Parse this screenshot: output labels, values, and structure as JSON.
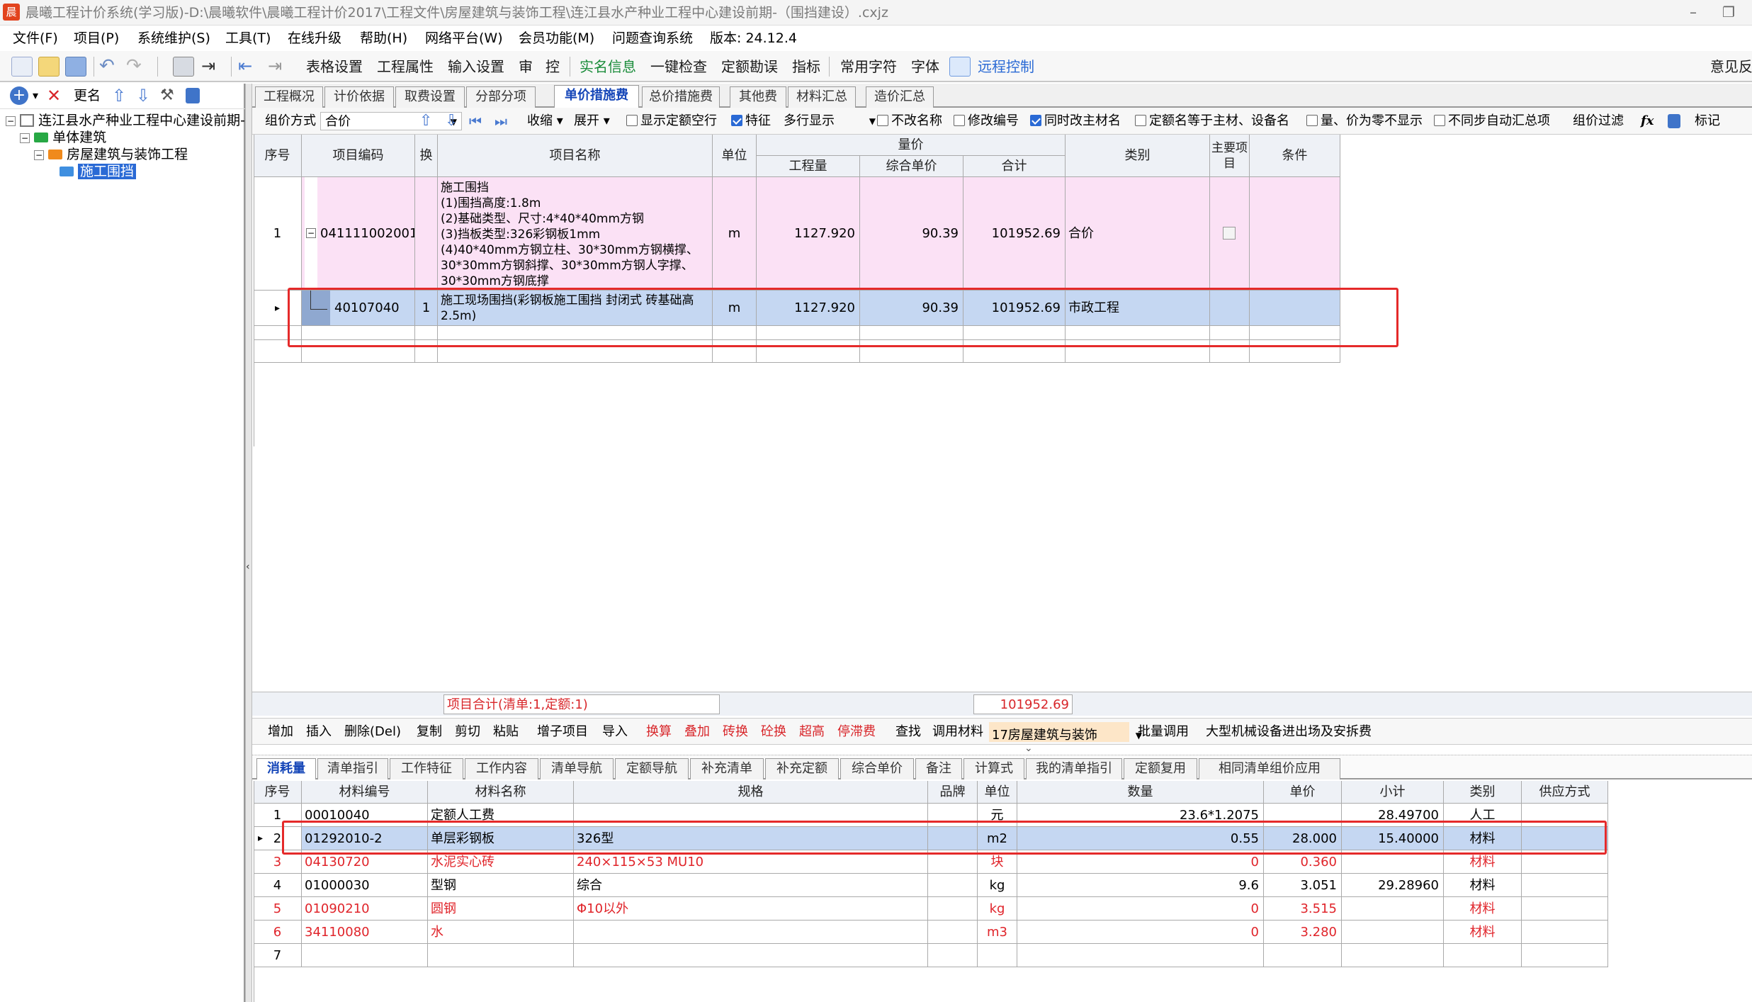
{
  "window": {
    "title": "晨曦工程计价系统(学习版)-D:\\晨曦软件\\晨曦工程计价2017\\工程文件\\房屋建筑与装饰工程\\连江县水产种业工程中心建设前期-（围挡建设）.cxjz",
    "logo": "晨"
  },
  "menu": [
    "文件(F)",
    "项目(P)",
    "系统维护(S)",
    "工具(T)",
    "在线升级",
    "帮助(H)",
    "网络平台(W)",
    "会员功能(M)",
    "问题查询系统",
    "版本: 24.12.4"
  ],
  "toolbar": {
    "items": [
      "表格设置",
      "工程属性",
      "输入设置",
      "审",
      "控",
      "实名信息",
      "一键检查",
      "定额勘误",
      "指标",
      "常用字符",
      "字体",
      "远程控制"
    ],
    "feedback": "意见反"
  },
  "left": {
    "rename": "更名",
    "tree": [
      "连江县水产种业工程中心建设前期-",
      "单体建筑",
      "房屋建筑与装饰工程",
      "施工围挡"
    ]
  },
  "tabs": [
    "工程概况",
    "计价依据",
    "取费设置",
    "分部分项",
    "单价措施费",
    "总价措施费",
    "其他费",
    "材料汇总",
    "造价汇总"
  ],
  "options": {
    "zujia_label": "组价方式",
    "zujia_value": "合价",
    "shousuo": "收缩",
    "zhankai": "展开",
    "xianshi": "显示定额空行",
    "tezheng": "特征",
    "duohang": "多行显示",
    "bugai": "不改名称",
    "xiugai": "修改编号",
    "tongshi": "同时改主材名",
    "dingming": "定额名等于主材、设备名",
    "liangjia": "量、价为零不显示",
    "butongbu": "不同步自动汇总项",
    "guolv": "组价过滤",
    "fx": "fx",
    "biaoji": "标记"
  },
  "grid": {
    "headers": {
      "seq": "序号",
      "code": "项目编码",
      "huan": "换",
      "name": "项目名称",
      "unit": "单位",
      "liangjia": "量价",
      "qty": "工程量",
      "price": "综合单价",
      "total": "合计",
      "type": "类别",
      "main": "主要项目",
      "cond": "条件"
    },
    "row1": {
      "seq": "1",
      "code": "041111002001",
      "name": [
        "施工围挡",
        "(1)围挡高度:1.8m",
        "(2)基础类型、尺寸:4*40*40mm方钢",
        "(3)挡板类型:326彩钢板1mm",
        "(4)40*40mm方钢立柱、30*30mm方钢横撑、",
        "30*30mm方钢斜撑、30*30mm方钢人字撑、",
        "30*30mm方钢底撑"
      ],
      "unit": "m",
      "qty": "1127.920",
      "price": "90.39",
      "total": "101952.69",
      "type": "合价"
    },
    "row2": {
      "pointer": "▸",
      "code": "40107040",
      "huan": "1",
      "name": "施工现场围挡(彩钢板施工围挡 封闭式 砖基础高2.5m)",
      "unit": "m",
      "qty": "1127.920",
      "price": "90.39",
      "total": "101952.69",
      "type": "市政工程"
    },
    "sum_label": "项目合计(清单:1,定额:1)",
    "sum_value": "101952.69"
  },
  "bottom_tools": [
    "增加",
    "插入",
    "删除(Del)",
    "复制",
    "剪切",
    "粘贴",
    "增子项目",
    "导入",
    "换算",
    "叠加",
    "砖换",
    "砼换",
    "超高",
    "停滞费",
    "查找",
    "调用材料",
    "17房屋建筑与装饰",
    "批量调用",
    "大型机械设备进出场及安拆费"
  ],
  "bottom_tabs": [
    "消耗量",
    "清单指引",
    "工作特征",
    "工作内容",
    "清单导航",
    "定额导航",
    "补充清单",
    "补充定额",
    "综合单价",
    "备注",
    "计算式",
    "我的清单指引",
    "定额复用",
    "相同清单组价应用"
  ],
  "mat": {
    "headers": [
      "序号",
      "材料编号",
      "材料名称",
      "规格",
      "品牌",
      "单位",
      "数量",
      "单价",
      "小计",
      "类别",
      "供应方式"
    ],
    "rows": [
      {
        "seq": "1",
        "code": "00010040",
        "name": "定额人工费",
        "spec": "",
        "unit": "元",
        "qty": "23.6*1.2075",
        "price": "",
        "sub": "28.49700",
        "type": "人工",
        "red": false
      },
      {
        "seq": "2",
        "code": "01292010-2",
        "name": "单层彩钢板",
        "spec": "326型",
        "unit": "m2",
        "qty": "0.55",
        "price": "28.000",
        "sub": "15.40000",
        "type": "材料",
        "red": false
      },
      {
        "seq": "3",
        "code": "04130720",
        "name": "水泥实心砖",
        "spec": "240×115×53 MU10",
        "unit": "块",
        "qty": "0",
        "price": "0.360",
        "sub": "",
        "type": "材料",
        "red": true
      },
      {
        "seq": "4",
        "code": "01000030",
        "name": "型钢",
        "spec": "综合",
        "unit": "kg",
        "qty": "9.6",
        "price": "3.051",
        "sub": "29.28960",
        "type": "材料",
        "red": false
      },
      {
        "seq": "5",
        "code": "01090210",
        "name": "圆钢",
        "spec": "Φ10以外",
        "unit": "kg",
        "qty": "0",
        "price": "3.515",
        "sub": "",
        "type": "材料",
        "red": true
      },
      {
        "seq": "6",
        "code": "34110080",
        "name": "水",
        "spec": "",
        "unit": "m3",
        "qty": "0",
        "price": "3.280",
        "sub": "",
        "type": "材料",
        "red": true
      },
      {
        "seq": "7",
        "code": "",
        "name": "",
        "spec": "",
        "unit": "",
        "qty": "",
        "price": "",
        "sub": "",
        "type": "",
        "red": false
      }
    ]
  }
}
